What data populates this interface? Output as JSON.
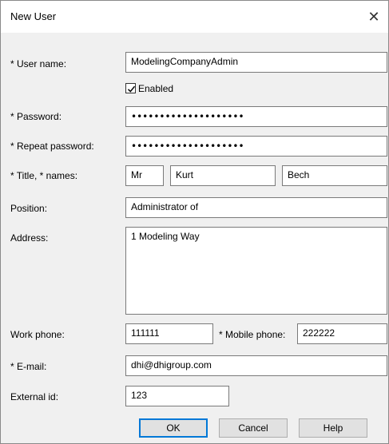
{
  "window": {
    "title": "New User",
    "close_glyph": "✕"
  },
  "form": {
    "user_name": {
      "label": "* User name:",
      "value": "ModelingCompanyAdmin"
    },
    "enabled": {
      "label": "Enabled",
      "checked": true
    },
    "password": {
      "label": "* Password:",
      "value": "••••••••••••••••••••"
    },
    "repeat_password": {
      "label": "* Repeat password:",
      "value": "••••••••••••••••••••"
    },
    "title_names": {
      "label": "* Title, * names:",
      "title": "Mr",
      "first": "Kurt",
      "last": "Bech"
    },
    "position": {
      "label": "Position:",
      "value": "Administrator of"
    },
    "address": {
      "label": "Address:",
      "value": "1 Modeling Way"
    },
    "work_phone": {
      "label": "Work phone:",
      "value": "111111"
    },
    "mobile_phone": {
      "label": "* Mobile phone:",
      "value": "222222"
    },
    "email": {
      "label": "* E-mail:",
      "value": "dhi@dhigroup.com"
    },
    "external_id": {
      "label": "External id:",
      "value": "123"
    }
  },
  "buttons": {
    "ok": "OK",
    "cancel": "Cancel",
    "help": "Help"
  },
  "icons": {
    "check": "checkmark-icon",
    "close": "close-icon"
  },
  "colors": {
    "accent": "#0078d7"
  }
}
